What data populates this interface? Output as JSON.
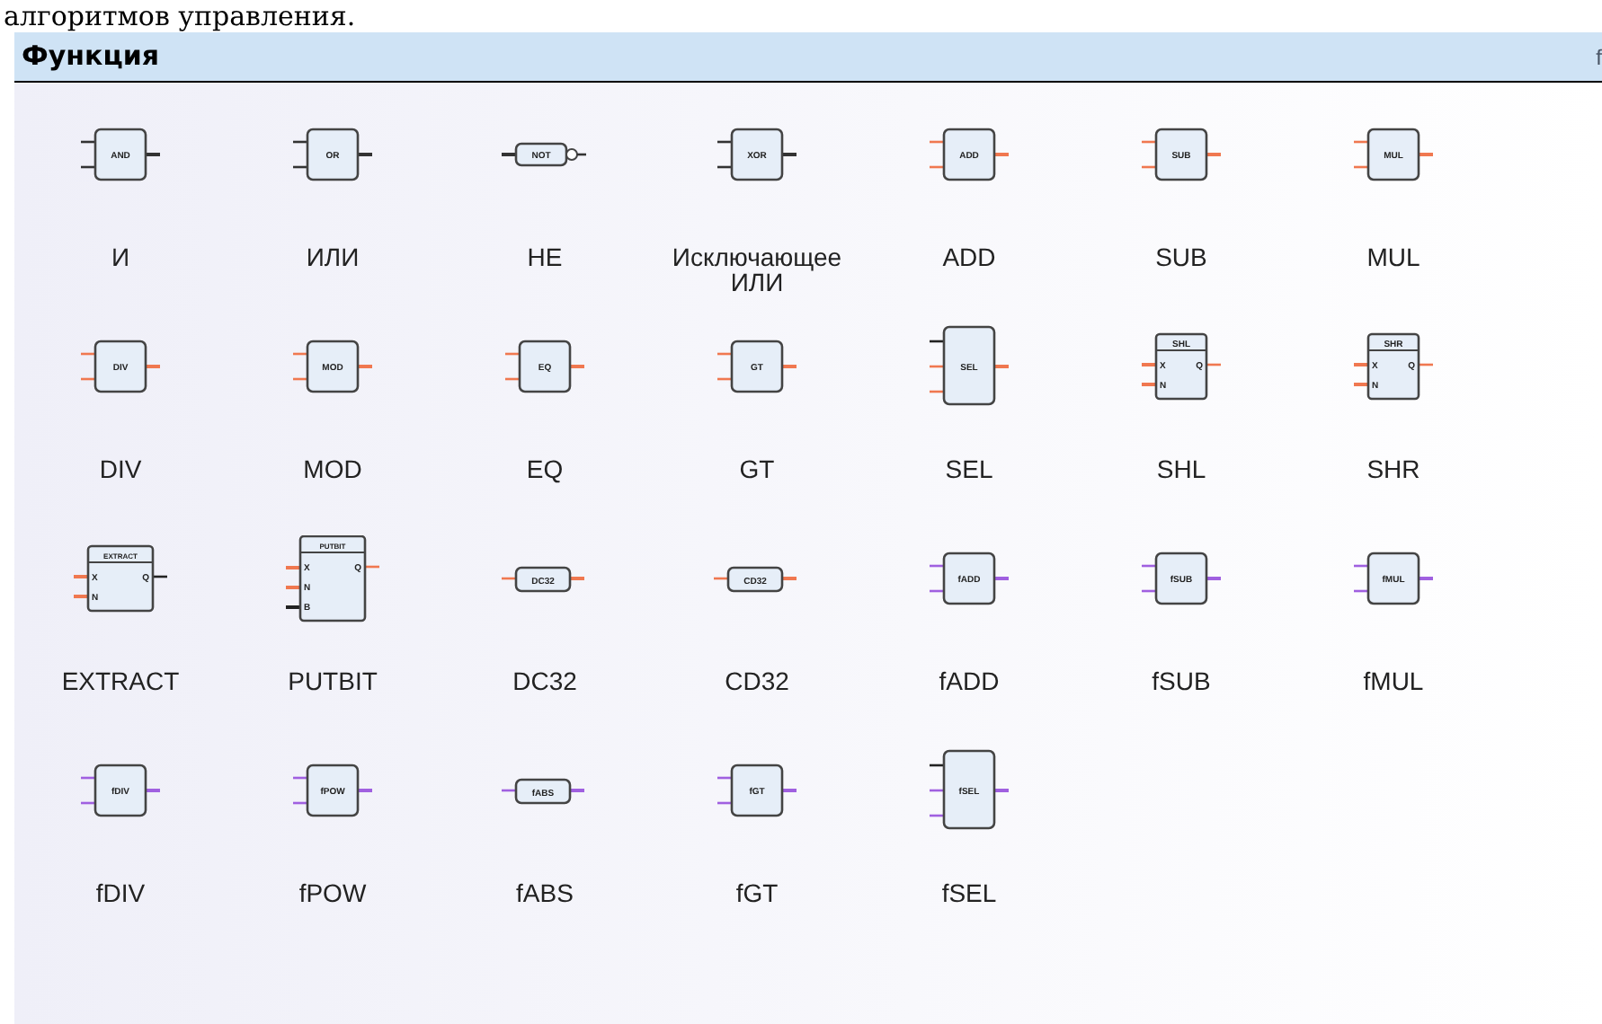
{
  "top_text": "алгоритмов управления.",
  "panel": {
    "title": "Функция",
    "corner_text": "f"
  },
  "items": [
    {
      "label": "И",
      "kind": "gate",
      "tag": "AND",
      "color": "#333333"
    },
    {
      "label": "ИЛИ",
      "kind": "gate",
      "tag": "OR",
      "color": "#333333"
    },
    {
      "label": "НЕ",
      "kind": "not",
      "tag": "NOT",
      "color": "#333333"
    },
    {
      "label": "Исключающее ИЛИ",
      "kind": "gate",
      "tag": "XOR",
      "color": "#333333"
    },
    {
      "label": "ADD",
      "kind": "gate",
      "tag": "ADD",
      "color": "#f07850"
    },
    {
      "label": "SUB",
      "kind": "gate",
      "tag": "SUB",
      "color": "#f07850"
    },
    {
      "label": "MUL",
      "kind": "gate",
      "tag": "MUL",
      "color": "#f07850"
    },
    {
      "label": "DIV",
      "kind": "gate",
      "tag": "DIV",
      "color": "#f07850"
    },
    {
      "label": "MOD",
      "kind": "gate",
      "tag": "MOD",
      "color": "#f07850"
    },
    {
      "label": "EQ",
      "kind": "gate",
      "tag": "EQ",
      "color": "#f07850"
    },
    {
      "label": "GT",
      "kind": "gate",
      "tag": "GT",
      "color": "#f07850"
    },
    {
      "label": "SEL",
      "kind": "sel",
      "tag": "SEL",
      "color": "#f07850"
    },
    {
      "label": "SHL",
      "kind": "header",
      "tag": "SHL",
      "color": "#f07850",
      "inputs": [
        "X",
        "N"
      ],
      "output": "Q"
    },
    {
      "label": "SHR",
      "kind": "header",
      "tag": "SHR",
      "color": "#f07850",
      "inputs": [
        "X",
        "N"
      ],
      "output": "Q"
    },
    {
      "label": "EXTRACT",
      "kind": "header",
      "tag": "EXTRACT",
      "color": "#f07850",
      "inputs": [
        "X",
        "N"
      ],
      "output": "Q"
    },
    {
      "label": "PUTBIT",
      "kind": "header",
      "tag": "PUTBIT",
      "color": "#f07850",
      "inputs": [
        "X",
        "N",
        "B"
      ],
      "output": "Q"
    },
    {
      "label": "DC32",
      "kind": "conv",
      "tag": "DC32",
      "color": "#f07850"
    },
    {
      "label": "CD32",
      "kind": "conv",
      "tag": "CD32",
      "color": "#f07850"
    },
    {
      "label": "fADD",
      "kind": "gate",
      "tag": "fADD",
      "color": "#a060e0"
    },
    {
      "label": "fSUB",
      "kind": "gate",
      "tag": "fSUB",
      "color": "#a060e0"
    },
    {
      "label": "fMUL",
      "kind": "gate",
      "tag": "fMUL",
      "color": "#a060e0"
    },
    {
      "label": "fDIV",
      "kind": "gate",
      "tag": "fDIV",
      "color": "#a060e0"
    },
    {
      "label": "fPOW",
      "kind": "gate",
      "tag": "fPOW",
      "color": "#a060e0"
    },
    {
      "label": "fABS",
      "kind": "conv",
      "tag": "fABS",
      "color": "#a060e0"
    },
    {
      "label": "fGT",
      "kind": "gate",
      "tag": "fGT",
      "color": "#a060e0"
    },
    {
      "label": "fSEL",
      "kind": "sel",
      "tag": "fSEL",
      "color": "#a060e0"
    }
  ]
}
